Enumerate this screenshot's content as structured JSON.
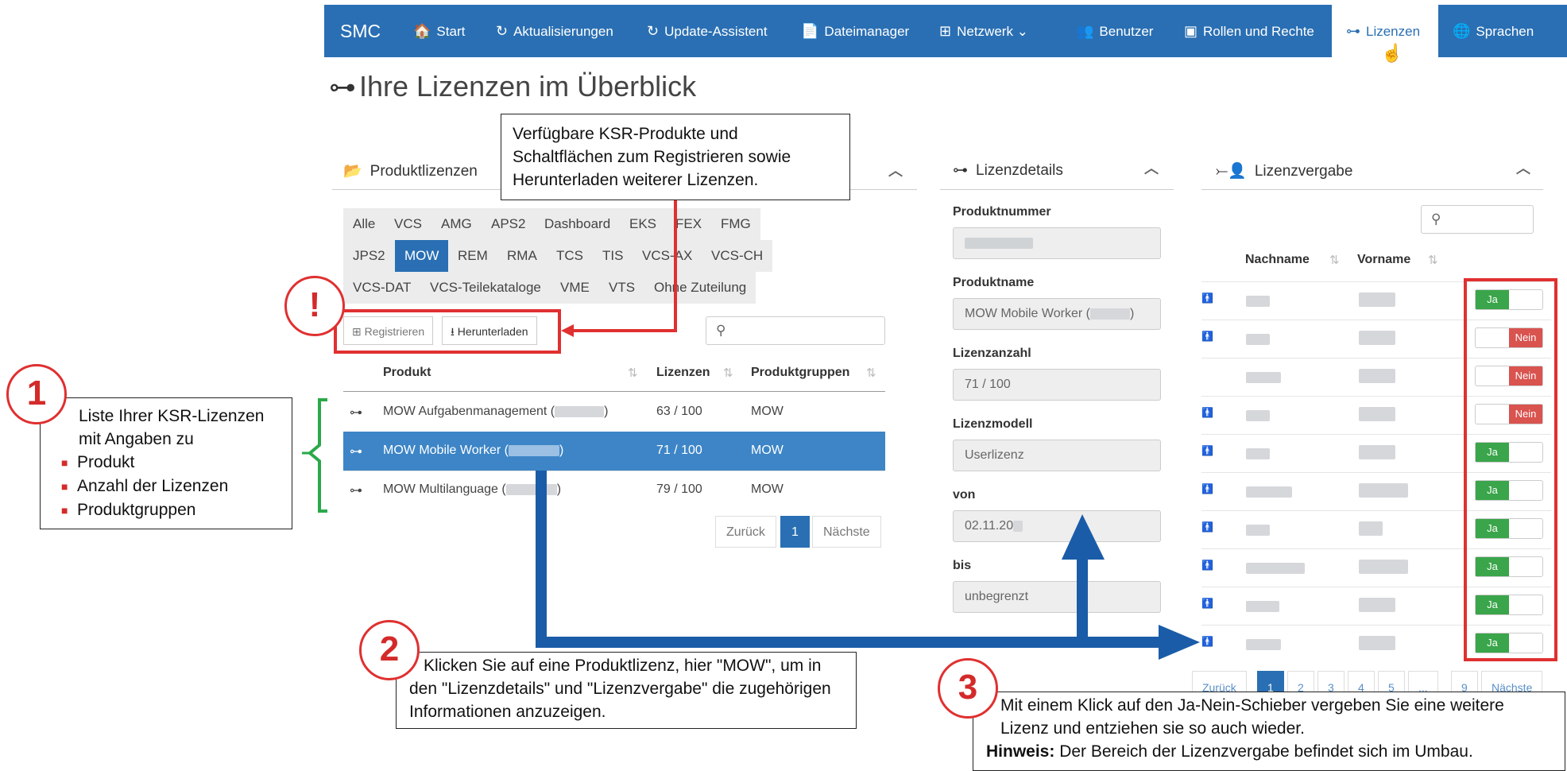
{
  "nav": {
    "brand": "SMC",
    "items": [
      {
        "label": "Start",
        "icon": "home-icon",
        "glyph": "🏠"
      },
      {
        "label": "Aktualisierungen",
        "icon": "refresh-icon",
        "glyph": "↻"
      },
      {
        "label": "Update-Assistent",
        "icon": "update-icon",
        "glyph": "↻"
      },
      {
        "label": "Dateimanager",
        "icon": "file-icon",
        "glyph": "📄"
      },
      {
        "label": "Netzwerk",
        "icon": "network-icon",
        "glyph": "⊞"
      },
      {
        "label": "Benutzer",
        "icon": "users-icon",
        "glyph": "👥"
      },
      {
        "label": "Rollen und Rechte",
        "icon": "id-card-icon",
        "glyph": "▣"
      },
      {
        "label": "Lizenzen",
        "icon": "key-icon",
        "glyph": "⊶"
      },
      {
        "label": "Sprachen",
        "icon": "globe-icon",
        "glyph": "🌐"
      }
    ]
  },
  "page": {
    "title": "Ihre Lizenzen im Überblick"
  },
  "produktlizenzen": {
    "title": "Produktlizenzen",
    "tabs": [
      "Alle",
      "VCS",
      "AMG",
      "APS2",
      "Dashboard",
      "EKS",
      "FEX",
      "FMG",
      "JPS2",
      "MOW",
      "REM",
      "RMA",
      "TCS",
      "TIS",
      "VCS-AX",
      "VCS-CH",
      "VCS-DAT",
      "VCS-Teilekataloge",
      "VME",
      "VTS",
      "Ohne Zuteilung"
    ],
    "active_tab": "MOW",
    "register_label": "Registrieren",
    "download_label": "Herunterladen",
    "headers": {
      "produkt": "Produkt",
      "lizenzen": "Lizenzen",
      "gruppen": "Produktgruppen"
    },
    "rows": [
      {
        "produkt": "MOW Aufgabenmanagement",
        "lizenzen": "63 / 100",
        "gruppe": "MOW",
        "selected": false
      },
      {
        "produkt": "MOW Mobile Worker",
        "lizenzen": "71 / 100",
        "gruppe": "MOW",
        "selected": true
      },
      {
        "produkt": "MOW Multilanguage",
        "lizenzen": "79 / 100",
        "gruppe": "MOW",
        "selected": false
      }
    ],
    "pager": {
      "prev": "Zurück",
      "current": "1",
      "next": "Nächste"
    }
  },
  "lizenzdetails": {
    "title": "Lizenzdetails",
    "fields": [
      {
        "label": "Produktnummer",
        "value": ""
      },
      {
        "label": "Produktname",
        "value": "MOW Mobile Worker ("
      },
      {
        "label": "Lizenzanzahl",
        "value": "71 / 100"
      },
      {
        "label": "Lizenzmodell",
        "value": "Userlizenz"
      },
      {
        "label": "von",
        "value": "02.11.20"
      },
      {
        "label": "bis",
        "value": "unbegrenzt"
      }
    ]
  },
  "lizenzvergabe": {
    "title": "Lizenzvergabe",
    "headers": {
      "nachname": "Nachname",
      "vorname": "Vorname"
    },
    "yes_label": "Ja",
    "no_label": "Nein",
    "rows": [
      true,
      false,
      false,
      false,
      true,
      true,
      true,
      true,
      true,
      true
    ],
    "pager": [
      "Zurück",
      "1",
      "2",
      "3",
      "4",
      "5",
      "...",
      "9",
      "Nächste"
    ]
  },
  "callouts": {
    "top": "Verfügbare KSR-Produkte und Schaltflächen zum Registrieren sowie Herunterladen weiterer Lizenzen.",
    "c1_marker": "1",
    "c1_text": "Liste Ihrer KSR-Lizenzen mit Angaben zu",
    "c1_items": [
      "Produkt",
      "Anzahl der Lizenzen",
      "Produktgruppen"
    ],
    "exclamation": "!",
    "c2_marker": "2",
    "c2_text": "Klicken Sie auf eine Produktlizenz, hier \"MOW\", um in den \"Lizenzdetails\" und \"Lizenzvergabe\" die zugehörigen Informationen anzuzeigen.",
    "c3_marker": "3",
    "c3_text": "Mit einem Klick auf den Ja-Nein-Schieber  vergeben Sie eine weitere Lizenz und entziehen sie so auch wieder.",
    "c3_hint_label": "Hinweis:",
    "c3_hint": "Der Bereich der Lizenzvergabe befindet sich im Umbau."
  },
  "colors": {
    "brand": "#2a6fb3",
    "selected_row": "#3d85c6",
    "callout_red": "#e03030",
    "arrow_blue": "#1a5ca8",
    "yes": "#3aa54a",
    "no": "#d9534f"
  }
}
